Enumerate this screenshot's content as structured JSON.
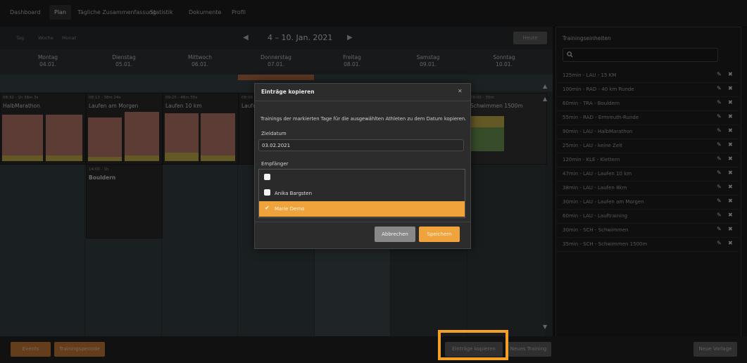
{
  "nav": {
    "items": [
      "Dashboard",
      "Plan",
      "Tägliche Zusammenfassung",
      "Statistik",
      "Dokumente",
      "Profil"
    ],
    "active": "Plan"
  },
  "calendar": {
    "views": [
      "Tag",
      "Woche",
      "Monat"
    ],
    "prev_icon": "caret-left-icon",
    "next_icon": "caret-right-icon",
    "week_title": "4 – 10. Jan. 2021",
    "today_label": "Heute",
    "days": [
      {
        "name": "Montag",
        "date": "04.01."
      },
      {
        "name": "Dienstag",
        "date": "05.01."
      },
      {
        "name": "Mittwoch",
        "date": "06.01."
      },
      {
        "name": "Donnerstag",
        "date": "07.01."
      },
      {
        "name": "Freitag",
        "date": "08.01."
      },
      {
        "name": "Samstag",
        "date": "09.01."
      },
      {
        "name": "Sonntag",
        "date": "10.01."
      }
    ],
    "entries": [
      {
        "meta": "08:32 - 1h 38m 3s",
        "name": "HalbMarathon"
      },
      {
        "meta": "08:13 - 38m 24s",
        "name": "Laufen am Morgen"
      },
      {
        "meta": "09:25 - 46m 55s",
        "name": "Laufen 10 km"
      },
      {
        "meta": "08:08 -",
        "name": "Laufen"
      },
      {
        "meta": "08:00 - 35m",
        "name": "Schwimmen 1500m"
      },
      {
        "meta": "14:00 - 1h",
        "name": "Bouldern"
      }
    ]
  },
  "bottom": {
    "events_label": "Events",
    "period_label": "Trainingsperiode",
    "copy_label": "Einträge kopieren",
    "new_training_label": "Neues Training",
    "new_template_label": "Neue Vorlage"
  },
  "sidebar": {
    "title": "Trainingseinheiten",
    "search_icon": "search-icon",
    "items": [
      "125min - LAU - 15 KM",
      "100min - RAD - 40 km Runde",
      "60min - TRA - Bouldern",
      "55min - RAD - Ermreuth-Runde",
      "90min - LAU - HalbMarathon",
      "25min - LAU - keine Zeit",
      "120min - KLE - Klettern",
      "47min - LAU - Laufen 10 km",
      "38min - LAU - Laufen 8km",
      "30min - LAU - Laufen am Morgen",
      "60min - LAU - Lauftraining",
      "30min - SCH - Schwimmen",
      "35min - SCH - Schwimmen 1500m"
    ]
  },
  "modal": {
    "title": "Einträge kopieren",
    "close_icon": "close-icon",
    "description": "Trainings der markierten Tage für die ausgewählten Athleten zu dem Datum kopieren.",
    "target_label": "Zieldatum",
    "target_value": "03.02.2021",
    "recipients_label": "Empfänger",
    "recipients": [
      {
        "name": "",
        "checked": false
      },
      {
        "name": "Anika Bargsten",
        "checked": false
      },
      {
        "name": "Marie Demo",
        "checked": true
      }
    ],
    "cancel_label": "Abbrechen",
    "save_label": "Speichern"
  },
  "colors": {
    "accent": "#f0a33b",
    "bar_salmon": "#b9786a",
    "bar_yellow": "#c8b14a",
    "bar_green": "#6f9a55"
  }
}
